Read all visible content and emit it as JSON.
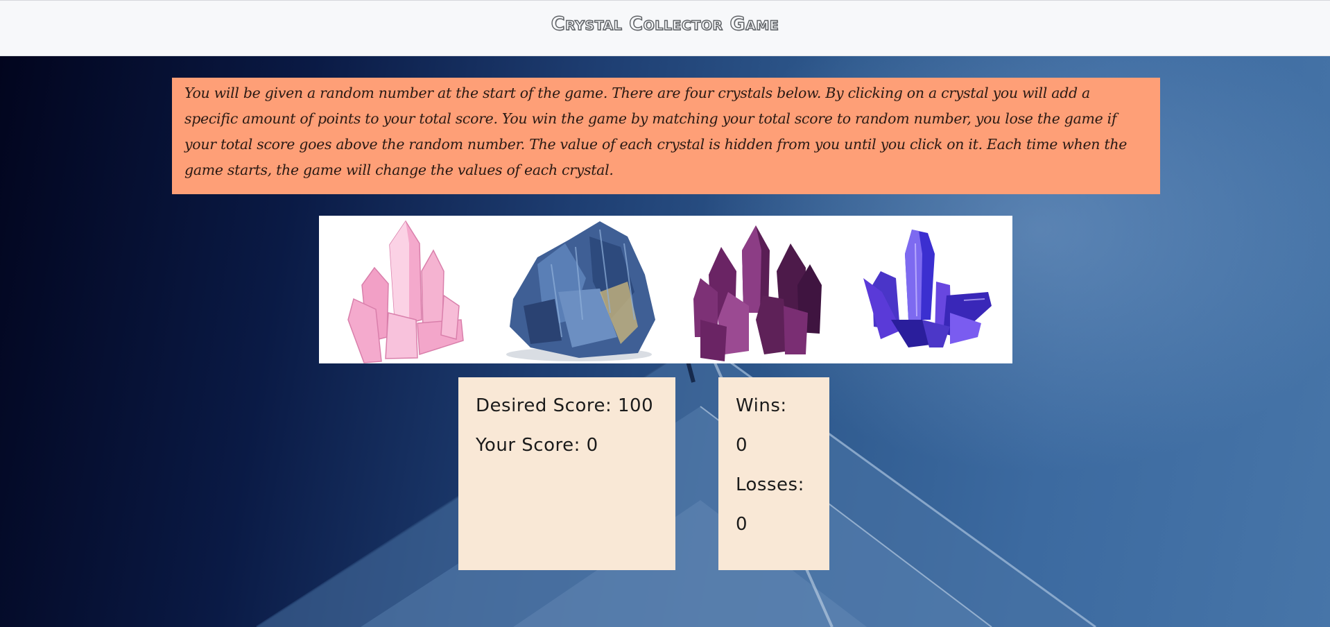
{
  "header": {
    "title": "Crystal Collector Game"
  },
  "instructions": {
    "text": "You will be given a random number at the start of the game. There are four crystals below. By clicking on a crystal you will add a specific amount of points to your total score. You win the game by matching your total score to random number, you lose the game if your total score goes above the random number. The value of each crystal is hidden from you until you click on it. Each time when the game starts, the game will change the values of each crystal."
  },
  "crystals": [
    {
      "icon": "pink-crystal-icon",
      "color": "#f2a6c8"
    },
    {
      "icon": "blue-kyanite-crystal-icon",
      "color": "#4a6aa0"
    },
    {
      "icon": "purple-amethyst-crystal-icon",
      "color": "#7b2a78"
    },
    {
      "icon": "violet-quartz-crystal-icon",
      "color": "#3b2fd0"
    }
  ],
  "score": {
    "desired_label": "Desired Score:",
    "desired_value": "100",
    "yours_label": "Your Score:",
    "yours_value": "0"
  },
  "record": {
    "wins_label": "Wins:",
    "wins_value": "0",
    "losses_label": "Losses:",
    "losses_value": "0"
  },
  "colors": {
    "header_bg": "#f7f8fa",
    "instructions_bg": "#fe9f77",
    "panel_bg": "#f9e8d6"
  }
}
